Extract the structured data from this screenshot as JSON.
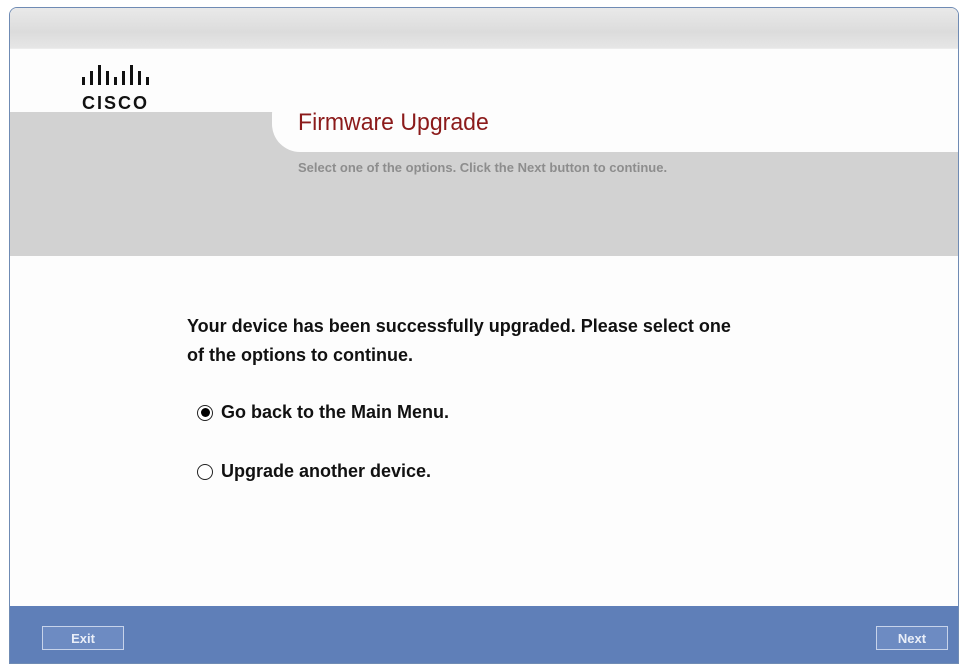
{
  "brand": {
    "logo_word": "CISCO"
  },
  "header": {
    "title": "Firmware Upgrade",
    "subtitle": "Select one of the options. Click the Next button to continue."
  },
  "main": {
    "message_line1": "Your device has been successfully upgraded. Please select one",
    "message_line2": "of the options to continue.",
    "options": [
      {
        "label": "Go back to the Main Menu.",
        "selected": true
      },
      {
        "label": "Upgrade another device.",
        "selected": false
      }
    ]
  },
  "footer": {
    "exit_label": "Exit",
    "next_label": "Next"
  },
  "colors": {
    "title": "#8b1a1a",
    "header_band": "#d2d2d2",
    "footer": "#5f7fb8"
  }
}
